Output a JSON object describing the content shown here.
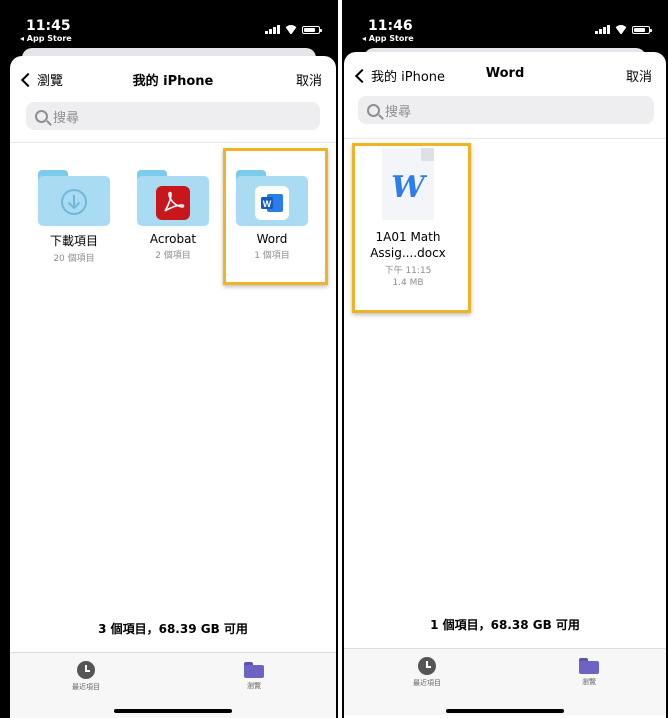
{
  "colors": {
    "accent": "#f0b323",
    "folder": "#a9dcf2",
    "acrobat": "#c8161d",
    "word": "#2b7de9",
    "browse": "#6c63c5"
  },
  "left": {
    "status": {
      "time": "11:45",
      "back_app": "◂ App Store"
    },
    "nav": {
      "back": "瀏覽",
      "title": "我的 iPhone",
      "cancel": "取消"
    },
    "search_placeholder": "搜尋",
    "folders": [
      {
        "name": "下載項目",
        "meta": "20 個項目",
        "icon": "download-icon"
      },
      {
        "name": "Acrobat",
        "meta": "2 個項目",
        "icon": "acrobat-icon"
      },
      {
        "name": "Word",
        "meta": "1 個項目",
        "icon": "word-icon"
      }
    ],
    "footer": "3 個項目，68.39 GB 可用",
    "tabs": {
      "recent": "最近項目",
      "browse": "瀏覽"
    }
  },
  "right": {
    "status": {
      "time": "11:46",
      "back_app": "◂ App Store"
    },
    "nav": {
      "back": "我的 iPhone",
      "title": "Word",
      "cancel": "取消"
    },
    "search_placeholder": "搜尋",
    "file": {
      "name_line1": "1A01 Math",
      "name_line2": "Assig....docx",
      "time": "下午 11:15",
      "size": "1.4 MB"
    },
    "footer": "1 個項目，68.38 GB 可用",
    "tabs": {
      "recent": "最近項目",
      "browse": "瀏覽"
    }
  }
}
